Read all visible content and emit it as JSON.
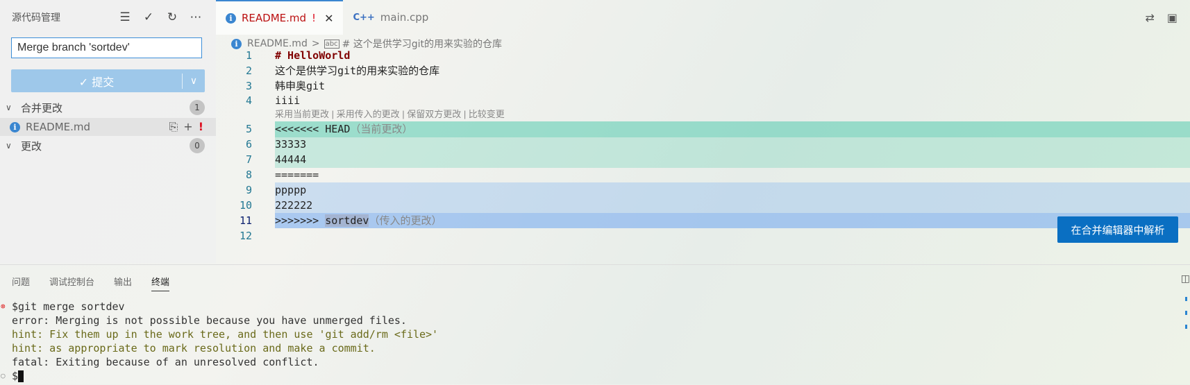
{
  "sidebar": {
    "title": "源代码管理",
    "commit_message": "Merge branch 'sortdev'",
    "commit_label": "✓ 提交",
    "merge_group": {
      "label": "合并更改",
      "count": "1"
    },
    "merge_file": {
      "name": "README.md",
      "flag": "!"
    },
    "changes_group": {
      "label": "更改",
      "count": "0"
    }
  },
  "tabs": [
    {
      "label": "README.md",
      "flag": "!",
      "active": true
    },
    {
      "label": "main.cpp",
      "active": false
    }
  ],
  "breadcrumb": {
    "file": "README.md",
    "section": "# 这个是供学习git的用来实验的仓库"
  },
  "editor": {
    "lines": [
      {
        "n": "1",
        "text": "# HelloWorld"
      },
      {
        "n": "2",
        "text": "这个是供学习git的用来实验的仓库"
      },
      {
        "n": "3",
        "text": "韩申奥git"
      },
      {
        "n": "4",
        "text": "iiii"
      },
      {
        "n": "5",
        "text": "<<<<<<< HEAD",
        "hint": "（当前更改）"
      },
      {
        "n": "6",
        "text": "33333"
      },
      {
        "n": "7",
        "text": "44444"
      },
      {
        "n": "8",
        "text": "======="
      },
      {
        "n": "9",
        "text": "ppppp"
      },
      {
        "n": "10",
        "text": "222222"
      },
      {
        "n": "11",
        "text": ">>>>>>> ",
        "sel": "sortdev",
        "hint": "（传入的更改）"
      },
      {
        "n": "12",
        "text": ""
      }
    ],
    "codelens": "采用当前更改 | 采用传入的更改 | 保留双方更改 | 比较变更",
    "resolve_button": "在合并编辑器中解析"
  },
  "panel": {
    "tabs": [
      "问题",
      "调试控制台",
      "输出",
      "终端"
    ],
    "active_tab": "终端",
    "terminal": [
      {
        "marker": "⊗",
        "text": "$git merge sortdev",
        "kind": "cmd"
      },
      {
        "marker": "",
        "text": "error: Merging is not possible because you have unmerged files.",
        "kind": "plain"
      },
      {
        "marker": "",
        "text": "hint: Fix them up in the work tree, and then use 'git add/rm <file>'",
        "kind": "hint"
      },
      {
        "marker": "",
        "text": "hint: as appropriate to mark resolution and make a commit.",
        "kind": "hint"
      },
      {
        "marker": "",
        "text": "fatal: Exiting because of an unresolved conflict.",
        "kind": "plain"
      },
      {
        "marker": "○",
        "text": "$",
        "kind": "prompt"
      }
    ]
  },
  "colors": {
    "accent": "#3a86d0",
    "resolve_button": "#0a6fc2",
    "commit_button": "#9ec8ea"
  }
}
